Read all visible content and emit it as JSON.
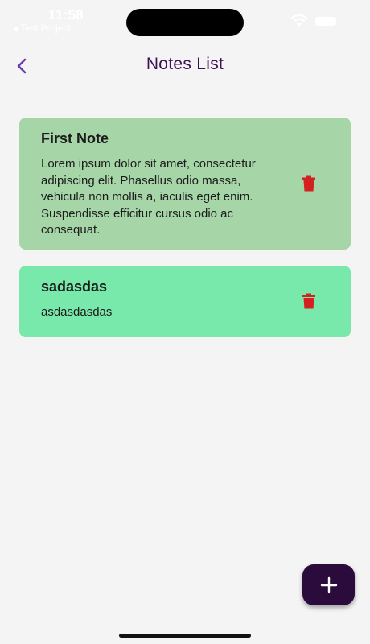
{
  "status_bar": {
    "time": "11:58",
    "back_app": "◂ Test Project"
  },
  "header": {
    "title": "Notes List",
    "back_icon": "chevron-left-icon"
  },
  "notes": [
    {
      "title": "First Note",
      "body": "Lorem ipsum dolor sit amet, consectetur adipiscing elit. Phasellus odio massa, vehicula non mollis a, iaculis eget enim. Suspendisse efficitur cursus odio ac consequat.",
      "color": "#a6d5a7",
      "delete_icon": "trash-icon"
    },
    {
      "title": "sadasdas",
      "body": "asdasdasdas",
      "color": "#79e8ab",
      "delete_icon": "trash-icon"
    }
  ],
  "fab": {
    "icon": "plus-icon",
    "color": "#2b0b3c"
  },
  "colors": {
    "accent": "#6a3fb5",
    "delete": "#d42020",
    "title_text": "#3b1250"
  }
}
